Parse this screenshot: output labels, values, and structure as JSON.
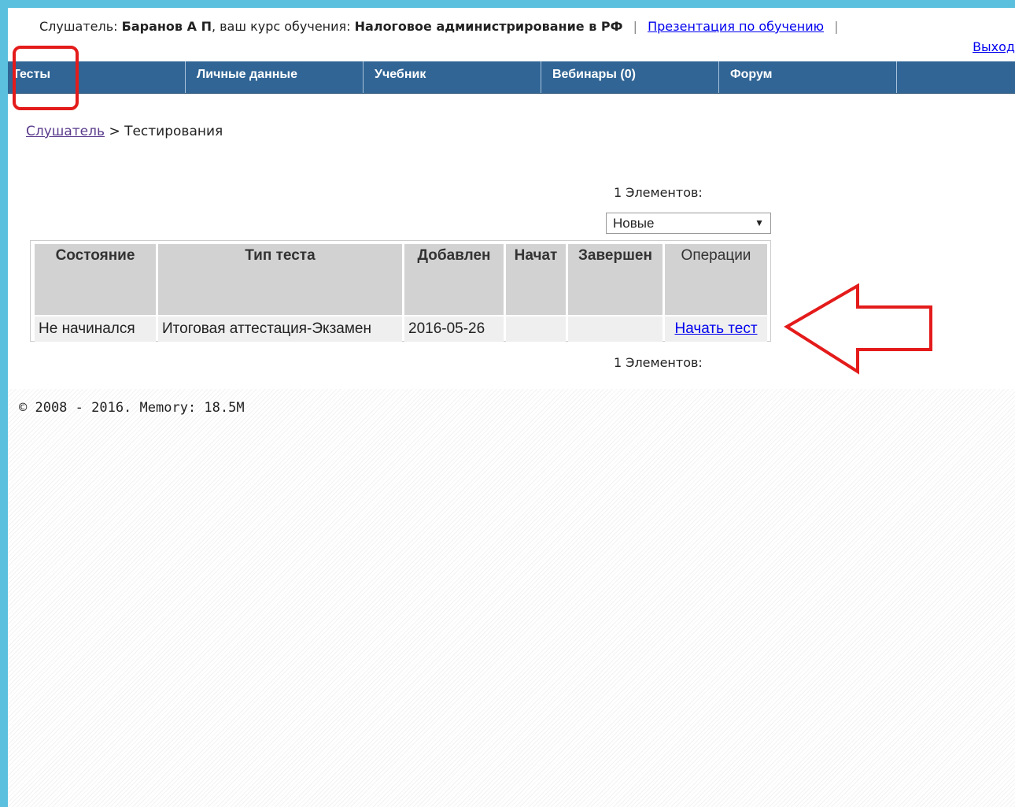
{
  "userbar": {
    "listener_label": "Слушатель:",
    "user_name": "Баранов А П",
    "course_label": ", ваш курс обучения:",
    "course_name": "Налоговое администрирование в РФ",
    "separator": "|",
    "presentation_link": "Презентация по обучению",
    "logout_link": "Выход"
  },
  "nav": {
    "items": [
      {
        "label": "Тесты"
      },
      {
        "label": "Личные данные"
      },
      {
        "label": "Учебник"
      },
      {
        "label": "Вебинары (0)"
      },
      {
        "label": "Форум"
      },
      {
        "label": ""
      }
    ]
  },
  "breadcrumb": {
    "root": "Слушатель",
    "separator": ">",
    "current": "Тестирования"
  },
  "list": {
    "count_top": "1 Элементов:",
    "count_bottom": "1 Элементов:",
    "filter_value": "Новые"
  },
  "table": {
    "headers": [
      "Состояние",
      "Тип теста",
      "Добавлен",
      "Начат",
      "Завершен",
      "Операции"
    ],
    "rows": [
      {
        "status": "Не начинался",
        "type": "Итоговая аттестация-Экзамен",
        "added": "2016-05-26",
        "started": "",
        "finished": "",
        "operation": "Начать тест"
      }
    ]
  },
  "footer": {
    "text": "© 2008 - 2016. Memory: 18.5M"
  },
  "colors": {
    "navbar": "#306595",
    "frame": "#5bc0de",
    "annotation": "#e41b1b"
  }
}
